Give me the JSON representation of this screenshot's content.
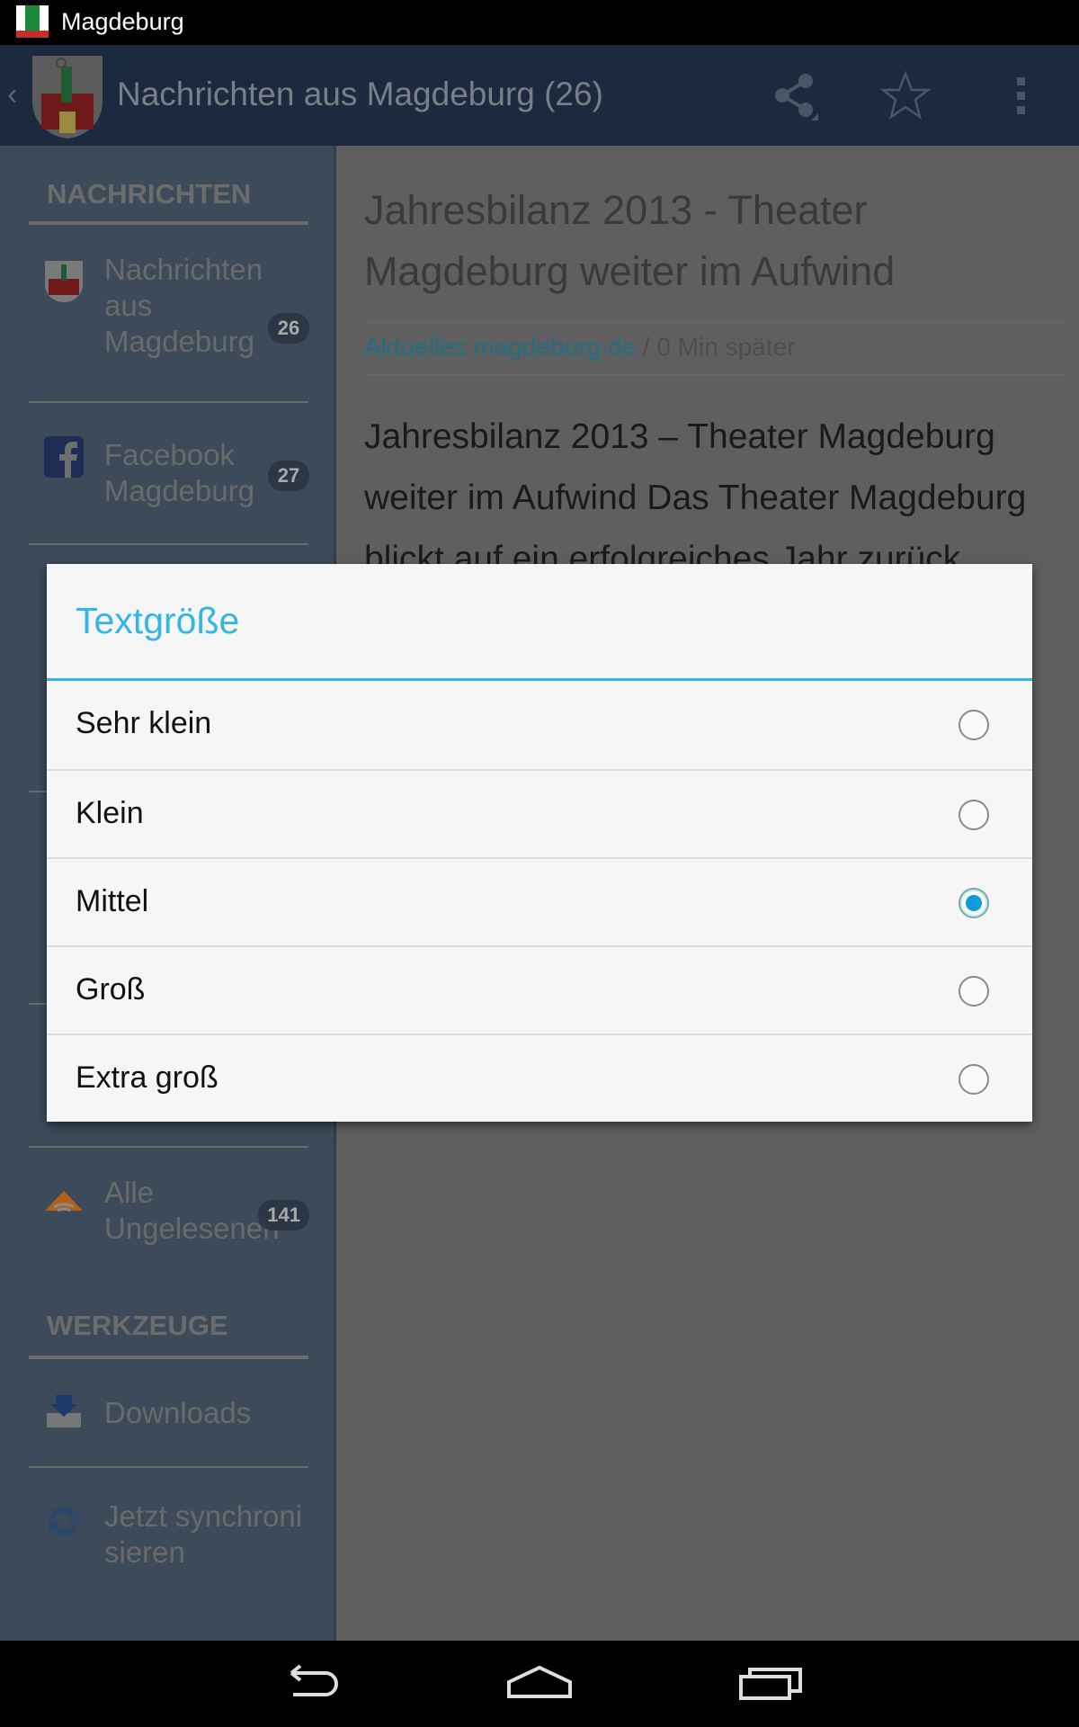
{
  "status_bar": {
    "app_name": "Magdeburg"
  },
  "action_bar": {
    "title": "Nachrichten aus Magdeburg (26)",
    "icons": [
      "share-icon",
      "star-icon",
      "overflow-menu-icon"
    ]
  },
  "sidebar": {
    "sections": [
      {
        "title": "NACHRICHTEN",
        "items": [
          {
            "label": "Nachrichten aus Magdeburg",
            "count": "26",
            "icon": "coat-of-arms-icon"
          },
          {
            "label": "Facebook Magdeburg",
            "count": "27",
            "icon": "facebook-icon"
          },
          {
            "label": "Alle Ungelesenen",
            "count": "141",
            "icon": "rss-icon"
          }
        ]
      },
      {
        "title": "WERKZEUGE",
        "items": [
          {
            "label": "Downloads",
            "icon": "download-icon"
          },
          {
            "label": "Jetzt synchronisieren",
            "icon": "sync-icon"
          }
        ]
      }
    ]
  },
  "article": {
    "title": "Jahresbilanz 2013 - Theater Magdeburg weiter im Aufwind",
    "source": "Aktuelles magdeburg.de",
    "time": " / 0 Min später",
    "body": "Jahresbilanz 2013 – Theater Magdeburg weiter im Aufwind Das Theater Magdeburg blickt auf ein erfolgreiches Jahr zurück"
  },
  "dialog": {
    "title": "Textgröße",
    "options": [
      {
        "label": "Sehr klein",
        "selected": false
      },
      {
        "label": "Klein",
        "selected": false
      },
      {
        "label": "Mittel",
        "selected": true
      },
      {
        "label": "Groß",
        "selected": false
      },
      {
        "label": "Extra groß",
        "selected": false
      }
    ]
  },
  "colors": {
    "accent": "#33b5e5",
    "radio_selected": "#0e9bd8",
    "action_bar": "#1c2a40"
  }
}
